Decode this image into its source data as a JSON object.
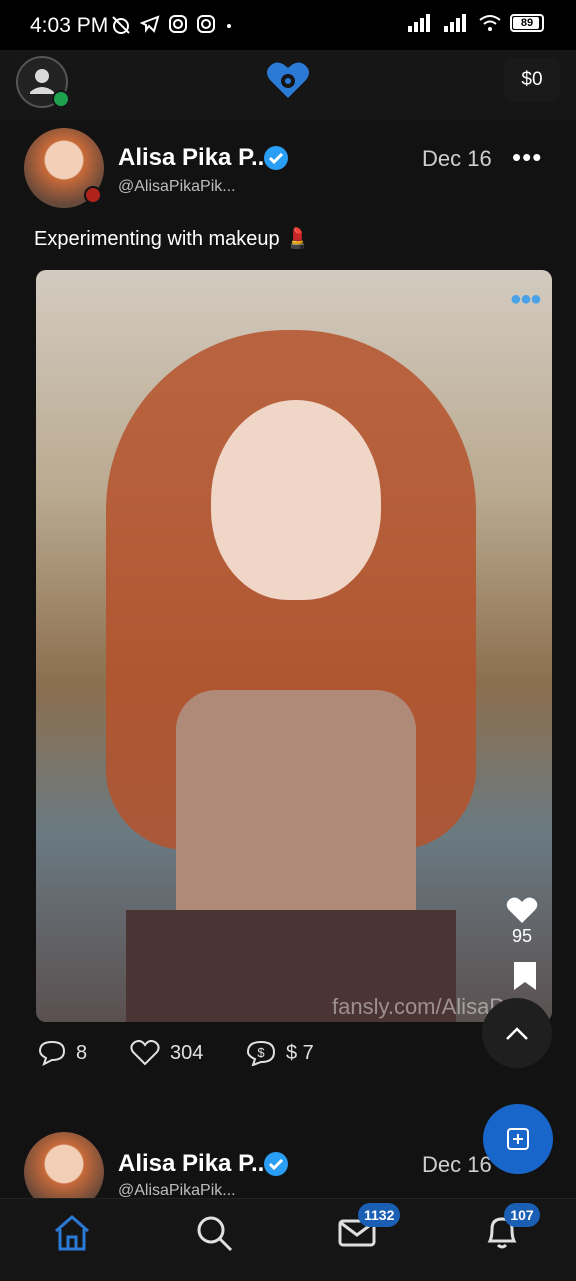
{
  "status_bar": {
    "time": "4:03 PM",
    "battery": "89"
  },
  "header": {
    "balance": "$0"
  },
  "post": {
    "author_name": "Alisa Pika P...",
    "handle": "@AlisaPikaPik...",
    "date": "Dec 16",
    "text": "Experimenting with makeup 💄",
    "media_likes": "95",
    "watermark": "fansly.com/AlisaP",
    "comments": "8",
    "likes": "304",
    "tips": "$ 7"
  },
  "post2": {
    "author_name": "Alisa Pika P...",
    "handle": "@AlisaPikaPik...",
    "date": "Dec 16"
  },
  "nav": {
    "messages_badge": "1132",
    "notifications_badge": "107"
  },
  "colors": {
    "accent": "#1866c9",
    "verified": "#2a9df4",
    "brand": "#2b7bd6"
  }
}
